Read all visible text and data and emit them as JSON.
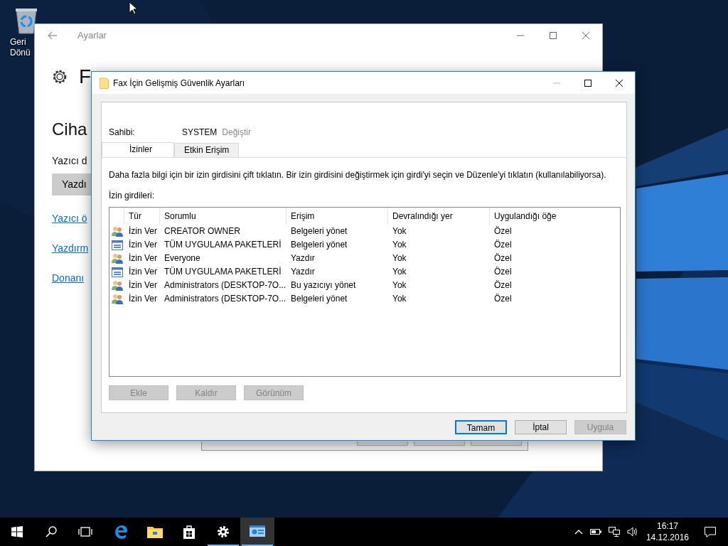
{
  "desktop": {
    "icons": [
      {
        "label": "Geri Dönü"
      }
    ]
  },
  "settings_window": {
    "title": "Ayarlar",
    "heading": "F",
    "section_title": "Ciha",
    "field_label": "Yazıcı d",
    "button": "Yazdı",
    "links": [
      "Yazıcı ö",
      "Yazdırm",
      "Donanı"
    ]
  },
  "dialog": {
    "title": "Fax İçin Gelişmiş Güvenlik Ayarları",
    "owner_label": "Sahibi:",
    "owner": "SYSTEM",
    "change_link": "Değiştir",
    "tabs": [
      {
        "label": "İzinler",
        "selected": true
      },
      {
        "label": "Etkin Erişim",
        "selected": false
      }
    ],
    "description": "Daha fazla bilgi için bir izin girdisini çift tıklatın. Bir izin girdisini değiştirmek için girdi'yi seçin ve Düzenle'yi tıklatın (kullanılabiliyorsa).",
    "entries_label": "İzin girdileri:",
    "columns": [
      "Tür",
      "Sorumlu",
      "Erişim",
      "Devralındığı yer",
      "Uygulandığı öğe"
    ],
    "rows": [
      {
        "kind": "group",
        "cells": [
          "İzin Ver",
          "CREATOR OWNER",
          "Belgeleri yönet",
          "Yok",
          "Özel"
        ]
      },
      {
        "kind": "package",
        "cells": [
          "İzin Ver",
          "TÜM UYGULAMA PAKETLERİ",
          "Belgeleri yönet",
          "Yok",
          "Özel"
        ]
      },
      {
        "kind": "group",
        "cells": [
          "İzin Ver",
          "Everyone",
          "Yazdır",
          "Yok",
          "Özel"
        ]
      },
      {
        "kind": "package",
        "cells": [
          "İzin Ver",
          "TÜM UYGULAMA PAKETLERİ",
          "Yazdır",
          "Yok",
          "Özel"
        ]
      },
      {
        "kind": "group",
        "cells": [
          "İzin Ver",
          "Administrators (DESKTOP-7O...",
          "Bu yazıcıyı yönet",
          "Yok",
          "Özel"
        ]
      },
      {
        "kind": "group",
        "cells": [
          "İzin Ver",
          "Administrators (DESKTOP-7O...",
          "Belgeleri yönet",
          "Yok",
          "Özel"
        ]
      }
    ],
    "list_buttons": [
      {
        "label": "Ekle",
        "disabled": true
      },
      {
        "label": "Kaldır",
        "disabled": true
      },
      {
        "label": "Görünüm",
        "disabled": true
      }
    ],
    "footer_buttons": [
      {
        "label": "Tamam",
        "default": true,
        "disabled": false
      },
      {
        "label": "İptal",
        "default": false,
        "disabled": false
      },
      {
        "label": "Uygula",
        "default": false,
        "disabled": true
      }
    ]
  },
  "taskbar": {
    "apps": [
      {
        "kind": "start",
        "running": false,
        "selected": false
      },
      {
        "kind": "search",
        "running": false,
        "selected": false
      },
      {
        "kind": "task-view",
        "running": false,
        "selected": false
      },
      {
        "kind": "edge",
        "running": false,
        "selected": false
      },
      {
        "kind": "explorer",
        "running": false,
        "selected": false
      },
      {
        "kind": "store",
        "running": false,
        "selected": false
      },
      {
        "kind": "settings",
        "running": true,
        "selected": false
      },
      {
        "kind": "control-panel",
        "running": true,
        "selected": true
      }
    ],
    "clock": {
      "time": "16:17",
      "date": "14.12.2016"
    }
  }
}
